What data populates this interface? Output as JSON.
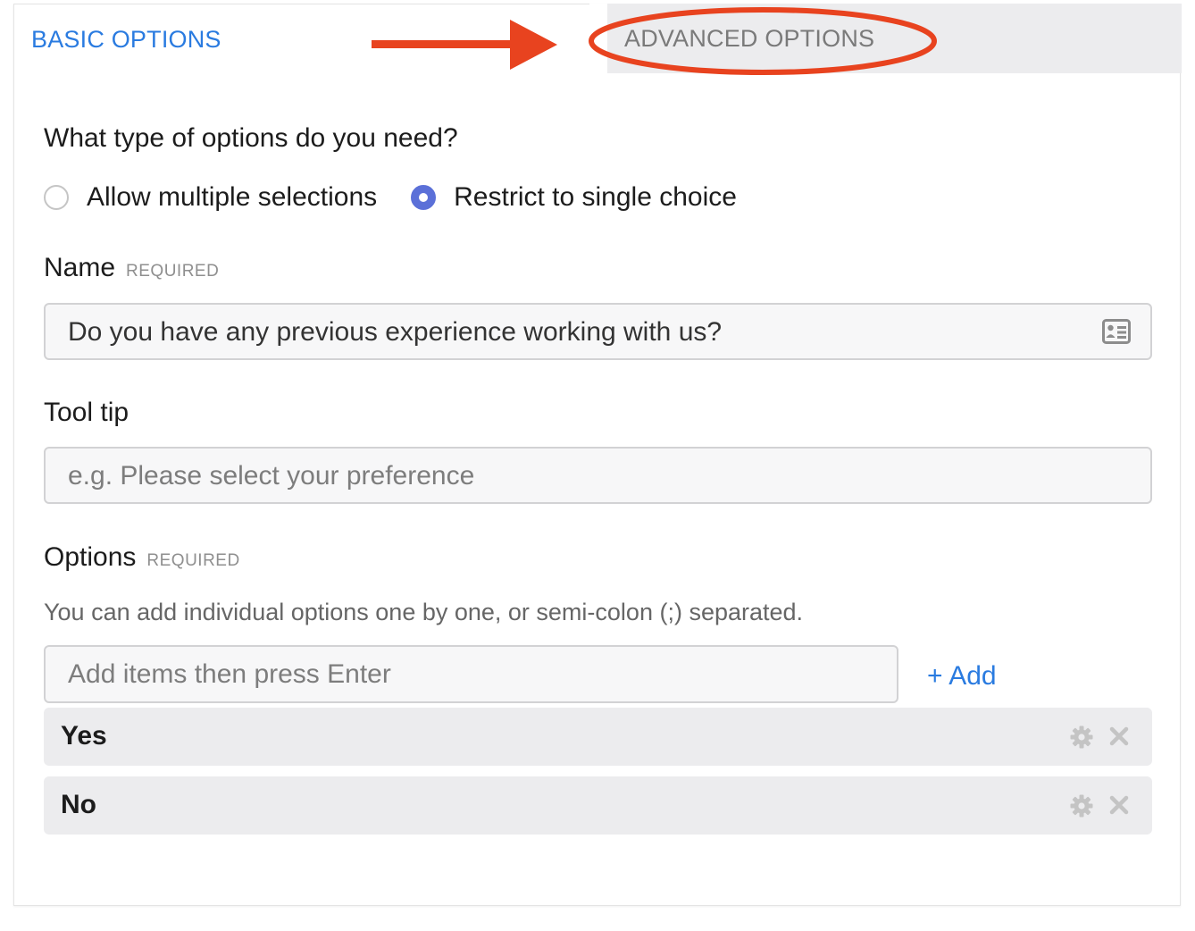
{
  "tabs": {
    "basic_label": "BASIC OPTIONS",
    "advanced_label": "ADVANCED OPTIONS",
    "active": "basic"
  },
  "annotation": {
    "color": "#e8431f",
    "arrow_icon": "arrow-right-icon",
    "highlight": "ellipse-around-advanced-tab"
  },
  "form": {
    "question": "What type of options do you need?",
    "radios": [
      {
        "label": "Allow multiple selections",
        "checked": false
      },
      {
        "label": "Restrict to single choice",
        "checked": true
      }
    ],
    "name": {
      "label": "Name",
      "required": "REQUIRED",
      "value": "Do you have any previous experience working with us?",
      "icon": "contact-card-icon"
    },
    "tooltip": {
      "label": "Tool tip",
      "placeholder": "e.g. Please select your preference"
    },
    "options": {
      "label": "Options",
      "required": "REQUIRED",
      "hint": "You can add individual options one by one, or semi-colon (;) separated.",
      "add_placeholder": "Add items then press Enter",
      "add_label": "+ Add",
      "items": [
        {
          "label": "Yes",
          "icons": [
            "gear-icon",
            "close-icon"
          ]
        },
        {
          "label": "No",
          "icons": [
            "gear-icon",
            "close-icon"
          ]
        }
      ]
    }
  },
  "colors": {
    "accent": "#2a7be0",
    "radio_checked": "#5b70d8",
    "annotation": "#e8431f"
  }
}
